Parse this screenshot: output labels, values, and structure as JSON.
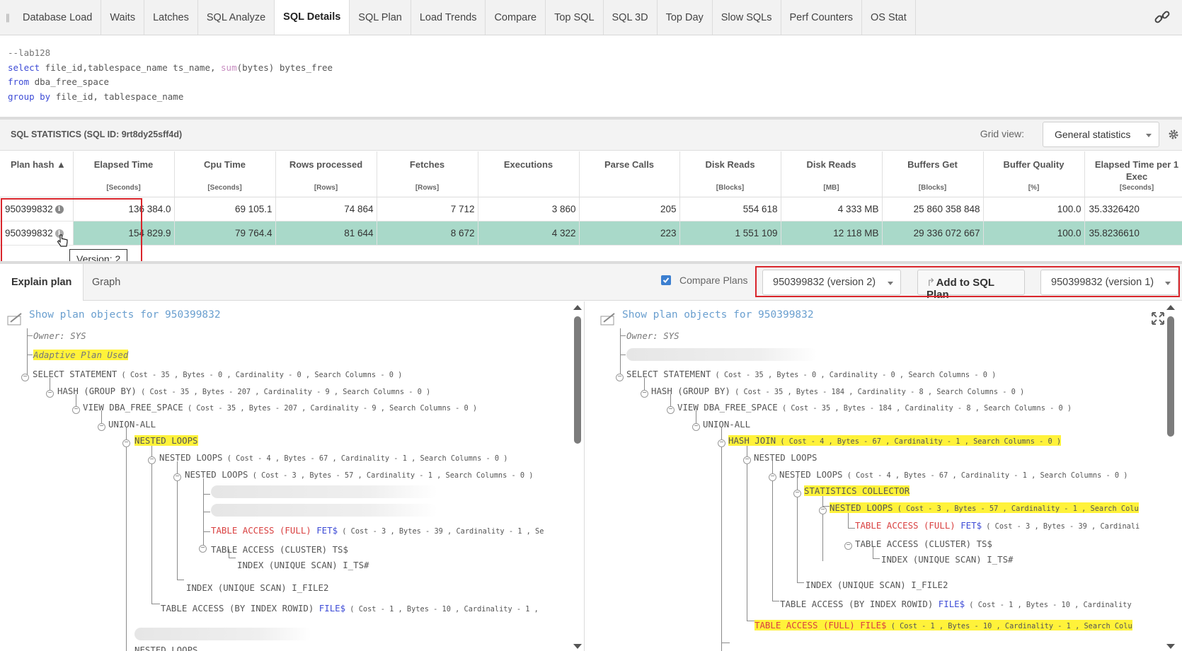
{
  "tabs": [
    {
      "label": "Database Load"
    },
    {
      "label": "Waits"
    },
    {
      "label": "Latches"
    },
    {
      "label": "SQL Analyze"
    },
    {
      "label": "SQL Details"
    },
    {
      "label": "SQL Plan"
    },
    {
      "label": "Load Trends"
    },
    {
      "label": "Compare"
    },
    {
      "label": "Top SQL"
    },
    {
      "label": "SQL 3D"
    },
    {
      "label": "Top Day"
    },
    {
      "label": "Slow SQLs"
    },
    {
      "label": "Perf Counters"
    },
    {
      "label": "OS Stat"
    }
  ],
  "active_tab": "SQL Details",
  "sql_text": {
    "comment": "--lab128",
    "select_kw": "select",
    "select_cols_1": " file_id,tablespace_name ts_name, ",
    "sum_fn": "sum",
    "select_cols_2": "(bytes) bytes_free",
    "from_kw": "from",
    "from_rest": " dba_free_space",
    "group_kw": "group by",
    "group_rest": " file_id, tablespace_name"
  },
  "stats": {
    "title": "SQL STATISTICS (SQL ID: 9rt8dy25sff4d)",
    "grid_view_label": "Grid view:",
    "grid_view_value": "General statistics",
    "columns": [
      {
        "name": "Plan hash ▲",
        "unit": ""
      },
      {
        "name": "Elapsed Time",
        "unit": "[Seconds]"
      },
      {
        "name": "Cpu Time",
        "unit": "[Seconds]"
      },
      {
        "name": "Rows processed",
        "unit": "[Rows]"
      },
      {
        "name": "Fetches",
        "unit": "[Rows]"
      },
      {
        "name": "Executions",
        "unit": ""
      },
      {
        "name": "Parse Calls",
        "unit": ""
      },
      {
        "name": "Disk Reads",
        "unit": "[Blocks]"
      },
      {
        "name": "Disk Reads",
        "unit": "[MB]"
      },
      {
        "name": "Buffers Get",
        "unit": "[Blocks]"
      },
      {
        "name": "Buffer Quality",
        "unit": "[%]"
      },
      {
        "name": "Elapsed Time per 1 Exec",
        "unit": "[Seconds]"
      }
    ],
    "rows": [
      [
        "950399832",
        "136 384.0",
        "69 105.1",
        "74 864",
        "7 712",
        "3 860",
        "205",
        "554 618",
        "4 333 MB",
        "25 860 358 848",
        "100.0",
        "35.3326420"
      ],
      [
        "950399832",
        "154 829.9",
        "79 764.4",
        "81 644",
        "8 672",
        "4 322",
        "223",
        "1 551 109",
        "12 118 MB",
        "29 336 072 667",
        "100.0",
        "35.8236610"
      ]
    ],
    "tooltip": "Version: 2"
  },
  "lower": {
    "tab_explain": "Explain plan",
    "tab_graph": "Graph",
    "compare_label": "Compare Plans",
    "left_plan_select": "950399832 (version 2)",
    "add_button": "Add to SQL Plan",
    "right_plan_select": "950399832 (version 1)"
  },
  "plan_left": {
    "show": "Show plan objects for 950399832",
    "owner": "Owner: SYS",
    "adaptive": "Adaptive Plan Used",
    "n1": "SELECT STATEMENT",
    "d1": " ( Cost - 35 , Bytes - 0 , Cardinality - 0 , Search Columns - 0 )",
    "n2": "HASH (GROUP BY)",
    "d2": " ( Cost - 35 , Bytes - 207 , Cardinality - 9 , Search Columns - 0 )",
    "n3": "VIEW DBA_FREE_SPACE",
    "d3": " ( Cost - 35 , Bytes - 207 , Cardinality - 9 , Search Columns - 0 )",
    "n4": "UNION-ALL",
    "n5": "NESTED LOOPS",
    "n6": "NESTED LOOPS",
    "d6": " ( Cost - 4 , Bytes - 67 , Cardinality - 1 , Search Columns - 0 )",
    "n7": "NESTED LOOPS",
    "d7": " ( Cost - 3 , Bytes - 57 , Cardinality - 1 , Search Columns - 0 )",
    "n8a": "TABLE ACCESS (FULL)",
    "n8b": " FET$",
    "d8": " ( Cost - 3 , Bytes - 39 , Cardinality - 1 , Se",
    "n9": "TABLE ACCESS (CLUSTER) TS$",
    "n10": "INDEX (UNIQUE SCAN) I_TS#",
    "n11": "INDEX (UNIQUE SCAN) I_FILE2",
    "n12a": "TABLE ACCESS (BY INDEX ROWID) ",
    "n12b": "FILE$",
    "d12": " ( Cost - 1 , Bytes - 10 , Cardinality - 1 ,",
    "n13": "NESTED LOOPS"
  },
  "plan_right": {
    "show": "Show plan objects for 950399832",
    "owner": "Owner: SYS",
    "n1": "SELECT STATEMENT",
    "d1": " ( Cost - 35 , Bytes - 0 , Cardinality - 0 , Search Columns - 0 )",
    "n2": "HASH (GROUP BY)",
    "d2": " ( Cost - 35 , Bytes - 184 , Cardinality - 8 , Search Columns - 0 )",
    "n3": "VIEW DBA_FREE_SPACE",
    "d3": " ( Cost - 35 , Bytes - 184 , Cardinality - 8 , Search Columns - 0 )",
    "n4": "UNION-ALL",
    "n5": "HASH JOIN",
    "d5": " ( Cost - 4 , Bytes - 67 , Cardinality - 1 , Search Columns - 0 )",
    "n6": "NESTED LOOPS",
    "n7": "NESTED LOOPS",
    "d7": " ( Cost - 4 , Bytes - 67 , Cardinality - 1 , Search Columns - 0 )",
    "n8": "STATISTICS COLLECTOR",
    "n9": "NESTED LOOPS",
    "d9": " ( Cost - 3 , Bytes - 57 , Cardinality - 1 , Search Colu",
    "n10a": "TABLE ACCESS (FULL)",
    "n10b": " FET$",
    "d10": " ( Cost - 3 , Bytes - 39 , Cardinali",
    "n11": "TABLE ACCESS (CLUSTER) TS$",
    "n12": "INDEX (UNIQUE SCAN) I_TS#",
    "n13": "INDEX (UNIQUE SCAN) I_FILE2",
    "n14a": "TABLE ACCESS (BY INDEX ROWID) ",
    "n14b": "FILE$",
    "d14": " ( Cost - 1 , Bytes - 10 , Cardinality",
    "n15": "TABLE ACCESS (FULL) FILE$",
    "d15": " ( Cost - 1 , Bytes - 10 , Cardinality - 1 , Search Colu"
  },
  "colors": {
    "accent": "#3c7fd0",
    "selected_row": "#a9d9c9",
    "highlight": "#fff23a",
    "red_box": "#d9252b"
  }
}
